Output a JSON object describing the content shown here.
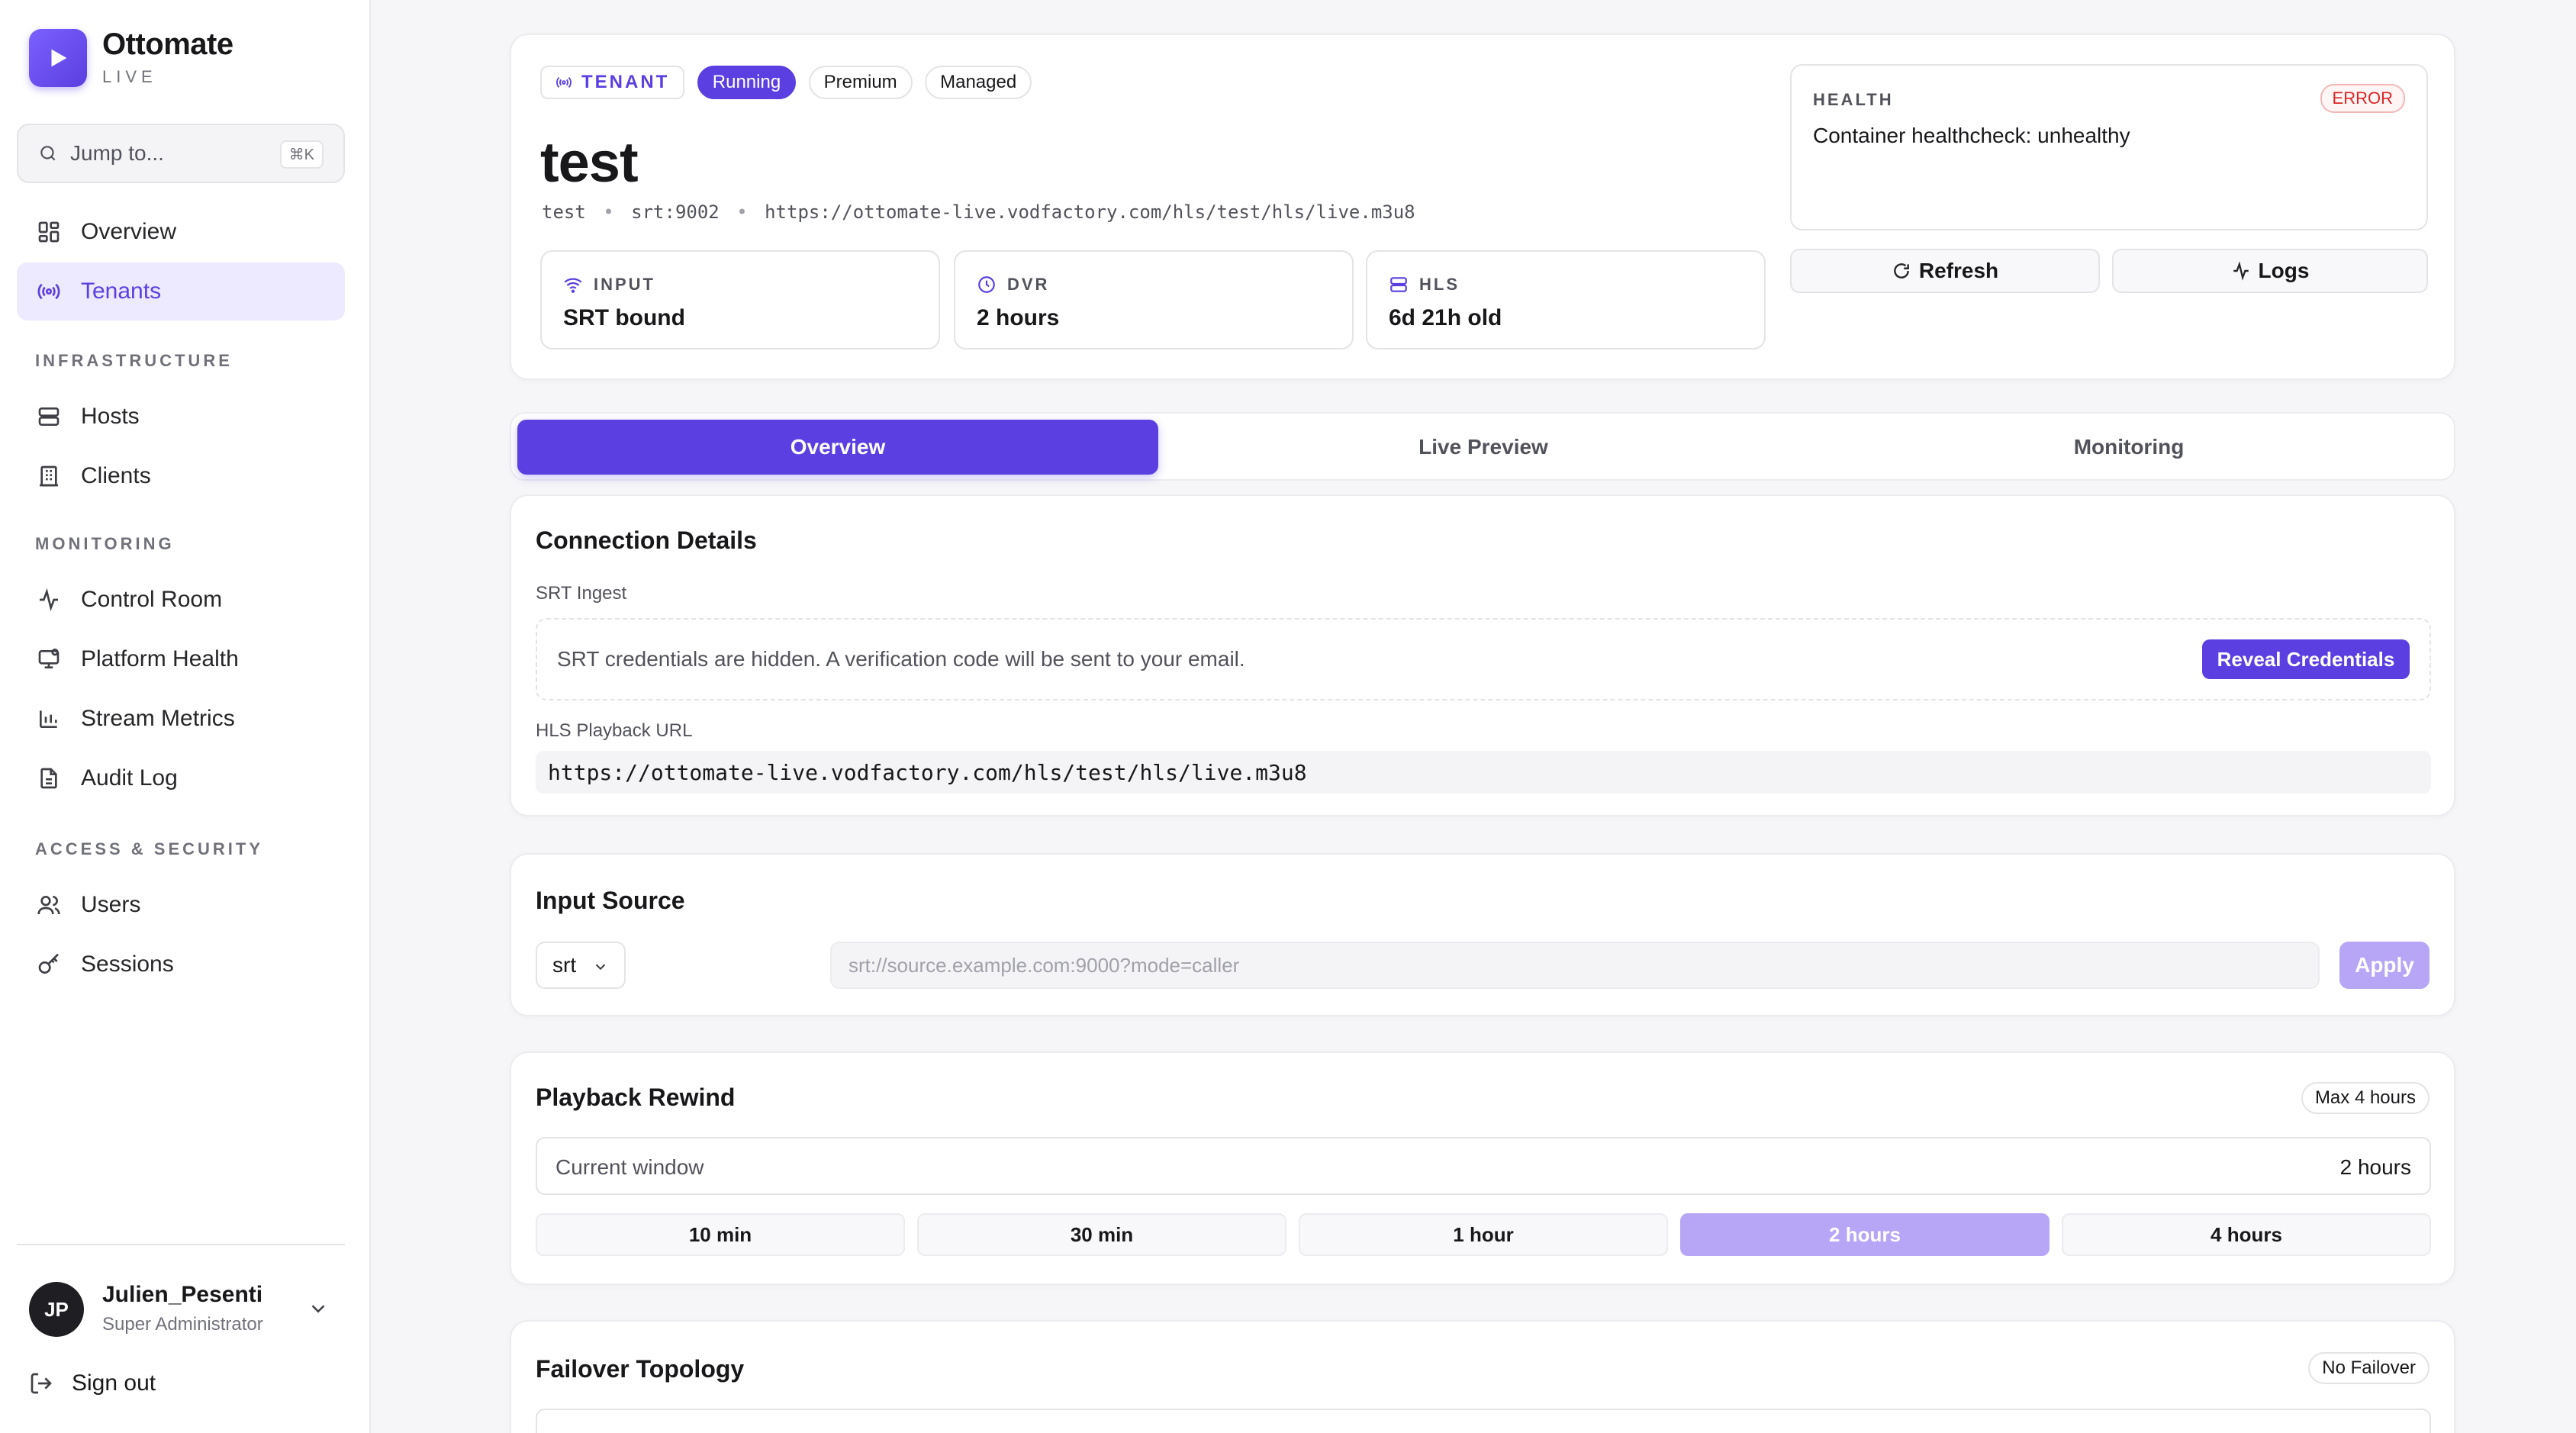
{
  "brand": {
    "name": "Ottomate",
    "sub": "LIVE"
  },
  "search": {
    "placeholder": "Jump to...",
    "shortcut": "⌘K"
  },
  "nav": {
    "overview": "Overview",
    "tenants": "Tenants",
    "sections": {
      "infrastructure": "INFRASTRUCTURE",
      "monitoring": "MONITORING",
      "access": "ACCESS & SECURITY"
    },
    "hosts": "Hosts",
    "clients": "Clients",
    "control_room": "Control Room",
    "platform_health": "Platform Health",
    "stream_metrics": "Stream Metrics",
    "audit_log": "Audit Log",
    "users": "Users",
    "sessions": "Sessions"
  },
  "user": {
    "initials": "JP",
    "name": "Julien_Pesenti",
    "role": "Super Administrator",
    "sign_out": "Sign out"
  },
  "header": {
    "badges": {
      "tenant": "TENANT",
      "status": "Running",
      "tier": "Premium",
      "mode": "Managed"
    },
    "title": "test",
    "meta": {
      "id": "test",
      "port": "srt:9002",
      "url": "https://ottomate-live.vodfactory.com/hls/test/hls/live.m3u8"
    },
    "stats": {
      "input": {
        "label": "INPUT",
        "value": "SRT bound"
      },
      "dvr": {
        "label": "DVR",
        "value": "2 hours"
      },
      "hls": {
        "label": "HLS",
        "value": "6d 21h old"
      }
    },
    "health": {
      "label": "HEALTH",
      "badge": "ERROR",
      "message": "Container healthcheck: unhealthy"
    },
    "actions": {
      "refresh": "Refresh",
      "logs": "Logs"
    }
  },
  "tabs": {
    "overview": "Overview",
    "preview": "Live Preview",
    "monitoring": "Monitoring"
  },
  "connection": {
    "title": "Connection Details",
    "srt_label": "SRT Ingest",
    "hidden_msg": "SRT credentials are hidden. A verification code will be sent to your email.",
    "reveal": "Reveal Credentials",
    "hls_label": "HLS Playback URL",
    "hls_url": "https://ottomate-live.vodfactory.com/hls/test/hls/live.m3u8"
  },
  "input_source": {
    "title": "Input Source",
    "protocol": "srt",
    "placeholder": "srt://source.example.com:9000?mode=caller",
    "apply": "Apply"
  },
  "rewind": {
    "title": "Playback Rewind",
    "max": "Max 4 hours",
    "window_label": "Current window",
    "window_value": "2 hours",
    "options": [
      "10 min",
      "30 min",
      "1 hour",
      "2 hours",
      "4 hours"
    ],
    "selected_index": 3
  },
  "failover": {
    "title": "Failover Topology",
    "badge": "No Failover"
  },
  "colors": {
    "accent": "#5b3fe0",
    "accent_light": "#b7a6f5",
    "error": "#dc2626"
  }
}
